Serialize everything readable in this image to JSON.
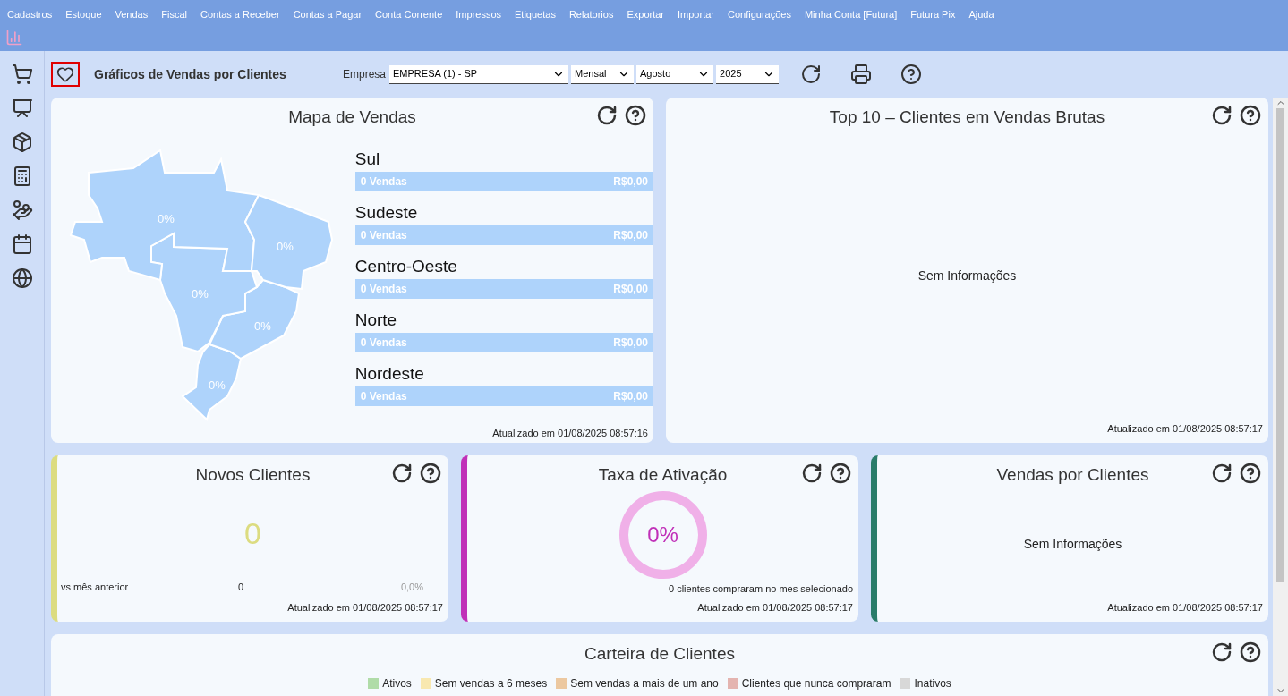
{
  "menu": [
    "Cadastros",
    "Estoque",
    "Vendas",
    "Fiscal",
    "Contas a Receber",
    "Contas a Pagar",
    "Conta Corrente",
    "Impressos",
    "Etiquetas",
    "Relatorios",
    "Exportar",
    "Importar",
    "Configurações",
    "Minha Conta [Futura]",
    "Futura Pix",
    "Ajuda"
  ],
  "page_title": "Gráficos de Vendas por Clientes",
  "favorite": {
    "selected": false
  },
  "filters": {
    "label": "Empresa",
    "dropdowns": [
      {
        "value": "EMPRESA (1) - SP",
        "kind": "wide"
      },
      {
        "value": "Mensal",
        "kind": "narrow"
      },
      {
        "value": "Agosto",
        "kind": "medium"
      },
      {
        "value": "2025",
        "kind": "narrow"
      }
    ]
  },
  "sales_map": {
    "title": "Mapa de Vendas",
    "regions": [
      {
        "name": "Sul",
        "sales": "0 Vendas",
        "amount": "R$0,00",
        "map_pct": "0%"
      },
      {
        "name": "Sudeste",
        "sales": "0 Vendas",
        "amount": "R$0,00",
        "map_pct": "0%"
      },
      {
        "name": "Centro-Oeste",
        "sales": "0 Vendas",
        "amount": "R$0,00",
        "map_pct": "0%"
      },
      {
        "name": "Norte",
        "sales": "0 Vendas",
        "amount": "R$0,00",
        "map_pct": "0%"
      },
      {
        "name": "Nordeste",
        "sales": "0 Vendas",
        "amount": "R$0,00",
        "map_pct": "0%"
      }
    ],
    "updated": "Atualizado em 01/08/2025 08:57:16"
  },
  "top10": {
    "title": "Top 10 – Clientes em Vendas Brutas",
    "empty": "Sem Informações",
    "updated": "Atualizado em 01/08/2025 08:57:17"
  },
  "new_clients": {
    "title": "Novos Clientes",
    "color": "#dcdc80",
    "value": "0",
    "compare_label": "vs mês anterior",
    "compare_value": "0",
    "compare_pct": "0,0%",
    "updated": "Atualizado em 01/08/2025 08:57:17"
  },
  "activation": {
    "title": "Taxa de Ativação",
    "color": "#c030b8",
    "value": "0%",
    "note": "0 clientes compraram no mes selecionado",
    "updated": "Atualizado em 01/08/2025 08:57:17"
  },
  "sales_by_client": {
    "title": "Vendas por Clientes",
    "color": "#2a7c6a",
    "empty": "Sem Informações",
    "updated": "Atualizado em 01/08/2025 08:57:17"
  },
  "portfolio": {
    "title": "Carteira de Clientes",
    "legend": [
      {
        "label": "Ativos",
        "color": "#b0dca8"
      },
      {
        "label": "Sem vendas a 6 meses",
        "color": "#f8e8b0"
      },
      {
        "label": "Sem vendas a mais de um ano",
        "color": "#ecc8a0"
      },
      {
        "label": "Clientes que nunca compraram",
        "color": "#e4b4b0"
      },
      {
        "label": "Inativos",
        "color": "#d8d8d8"
      }
    ]
  }
}
